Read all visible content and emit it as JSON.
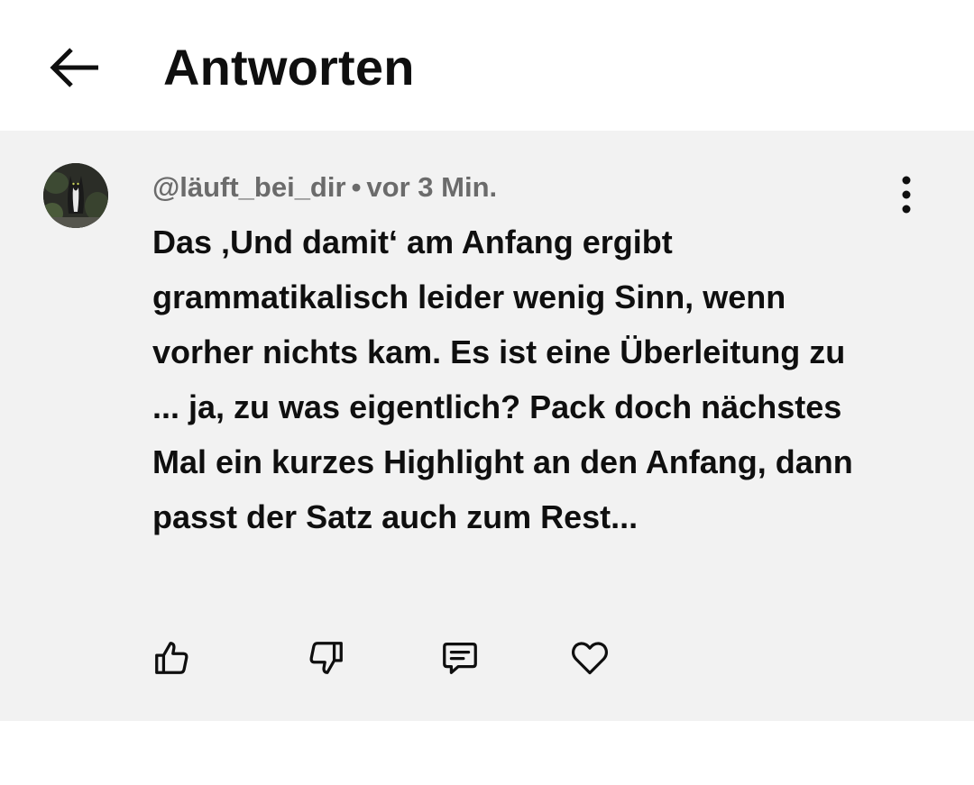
{
  "header": {
    "back_icon": "arrow-left-icon",
    "title": "Antworten"
  },
  "comment": {
    "avatar_icon": "avatar-cat-photo",
    "username": "@läuft_bei_dir",
    "separator": "•",
    "time": "vor 3 Min.",
    "more_icon": "more-vertical-icon",
    "text": "Das ‚Und damit‘ am Anfang ergibt grammatikalisch leider wenig Sinn, wenn vorher nichts kam. Es ist eine Überleitung zu ... ja, zu was eigentlich? Pack doch nächstes Mal ein kurzes Highlight an den Anfang, dann passt der Satz auch zum Rest...",
    "actions": [
      {
        "icon": "thumbs-up-icon"
      },
      {
        "icon": "thumbs-down-icon"
      },
      {
        "icon": "reply-comment-icon"
      },
      {
        "icon": "heart-icon"
      }
    ]
  },
  "colors": {
    "comment_background": "#f2f2f2",
    "text_primary": "#0f0f0f",
    "text_secondary": "#6b6b6b"
  }
}
